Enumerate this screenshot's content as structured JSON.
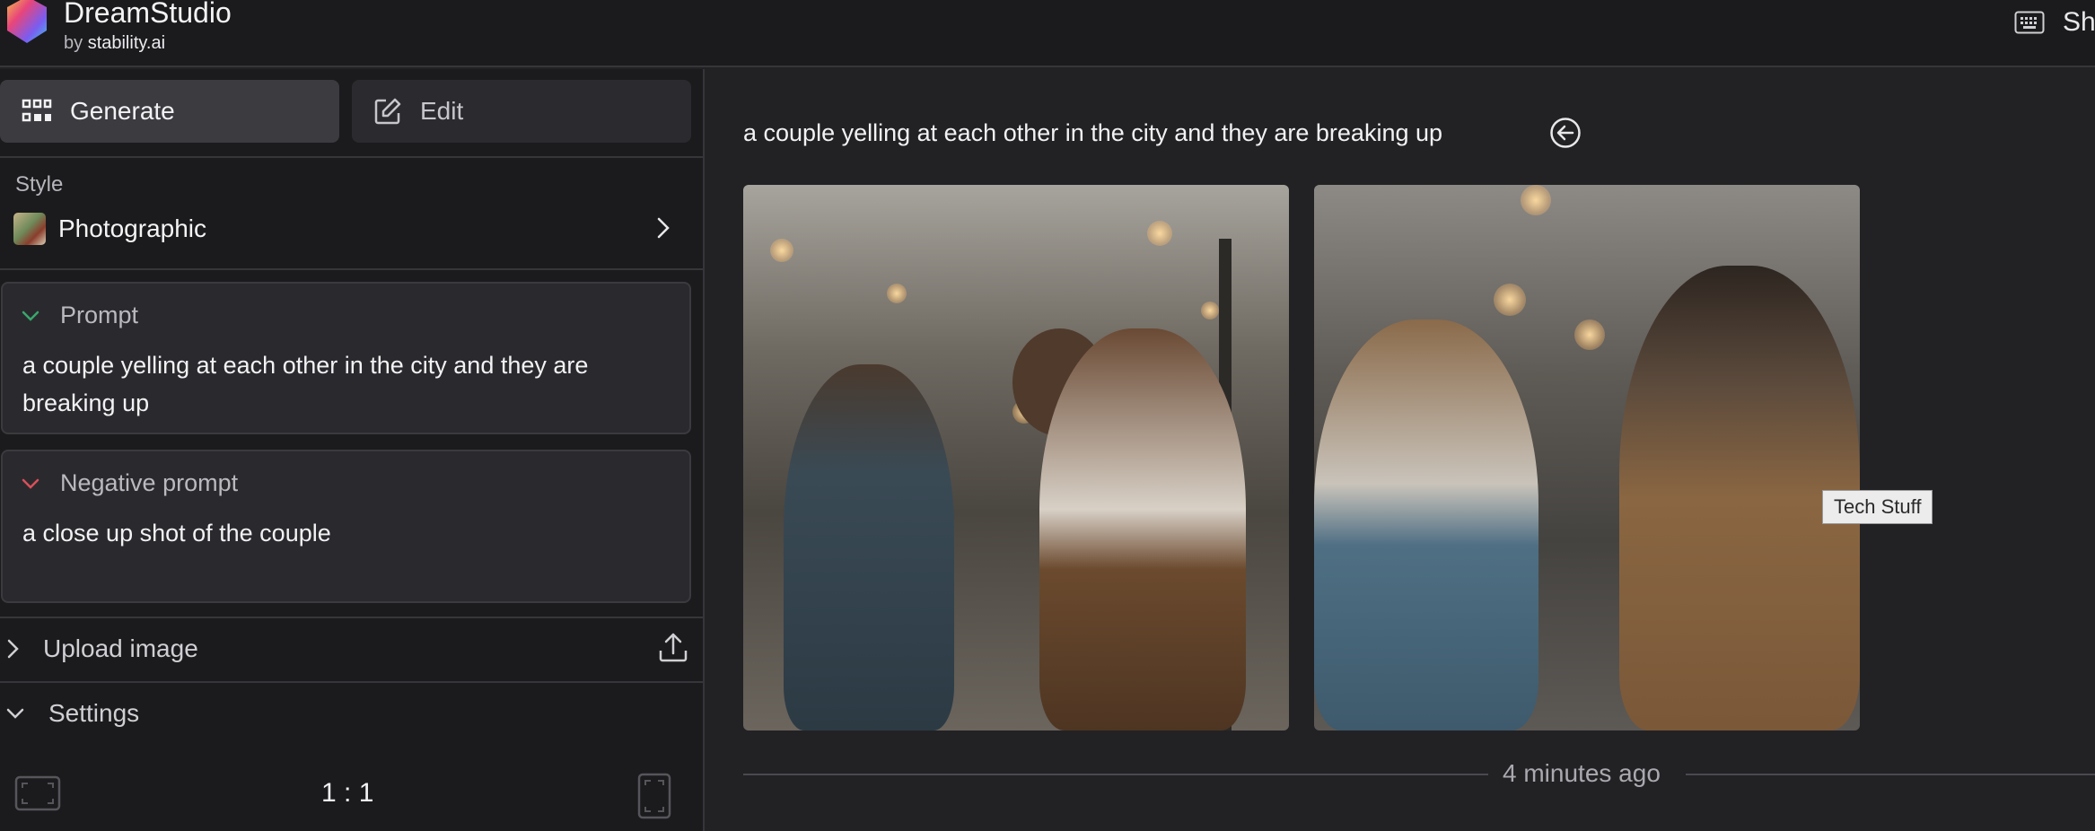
{
  "brand": {
    "name": "DreamStudio",
    "by_prefix": "by",
    "by_name": "stability.ai"
  },
  "topbar": {
    "right_text": "Sh"
  },
  "sidebar": {
    "tabs": [
      {
        "label": "Generate",
        "icon": "grid-icon",
        "active": true
      },
      {
        "label": "Edit",
        "icon": "edit-icon",
        "active": false
      }
    ],
    "style": {
      "label": "Style",
      "value": "Photographic"
    },
    "prompt": {
      "label": "Prompt",
      "value": "a couple yelling at each other in the city and they are breaking up"
    },
    "negative_prompt": {
      "label": "Negative prompt",
      "value": "a close up shot of the couple"
    },
    "upload": {
      "label": "Upload image"
    },
    "settings": {
      "label": "Settings"
    },
    "aspect_ratio": {
      "value": "1 : 1"
    }
  },
  "main": {
    "prompt_title": "a couple yelling at each other in the city and they are breaking up",
    "tooltip": "Tech Stuff",
    "timestamp": "4 minutes ago"
  },
  "colors": {
    "accent_prompt": "#3aa76d",
    "accent_negative": "#d9505a",
    "background": "#222225",
    "sidebar": "#1b1b1d"
  }
}
